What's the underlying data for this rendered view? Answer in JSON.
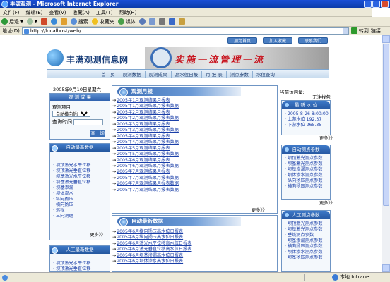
{
  "window": {
    "title": "丰满观测 - Microsoft Internet Explorer"
  },
  "menu": [
    "文件(F)",
    "编辑(E)",
    "查看(V)",
    "收藏(A)",
    "工具(T)",
    "帮助(H)"
  ],
  "toolbar": {
    "back": "后退",
    "search": "搜索",
    "favorites": "收藏夹",
    "media": "媒体"
  },
  "address": {
    "label": "地址(D)",
    "url": "http://localhost/web/",
    "go": "转到",
    "links": "链接"
  },
  "status": {
    "zone": "本地 Intranet"
  },
  "page": {
    "top_buttons": [
      "加为首页",
      "加入收藏",
      "联系我们"
    ],
    "site_name": "丰满观测信息网",
    "slogan": "实施一流管理一流",
    "nav": [
      "首　页",
      "观测数据",
      "观测成果",
      "高水位日报",
      "月 报 表",
      "测点参数",
      "水位查询"
    ],
    "date": "2005年9月10日星期六",
    "query_panel": {
      "title": "观 测 成 果",
      "item_label": "观测项目",
      "item_value": "自动横向拆压",
      "time_label": "查询时间",
      "button": "查　询"
    },
    "left_section1": {
      "title": "自动最新数据",
      "items": [
        "坝顶激光水平位移",
        "坝顶激光垂直位移",
        "坝基激光水平位移",
        "坝基激光垂直位移",
        "坝基渗漏",
        "坝体渗水",
        "纵向扬压",
        "横向扬压",
        "巡视",
        "三向测缝"
      ],
      "more": "更多》》"
    },
    "left_section2": {
      "title": "人工最新数据",
      "items": [
        "坝顶激光水平位移",
        "坝顶激光垂直位移"
      ]
    },
    "monthly": {
      "title": "观测月报",
      "items": [
        "2005年1月观测结果月报表",
        "2005年1月观测结果月报表数据",
        "2005年2月观测结果月报表",
        "2005年2月观测结果月报表数据",
        "2005年3月观测结果月报表",
        "2005年3月观测结果月报表数据",
        "2005年4月观测结果月报表",
        "2005年4月观测结果月报表数据",
        "2005年5月观测结果月报表",
        "2005年5月观测结果月报表数据",
        "2005年6月观测结果月报表",
        "2005年6月观测结果月报表数据",
        "2005年7月观测结果月报表",
        "2005年7月观测结果月报表数据"
      ],
      "more": "更多》》"
    },
    "auto_data": {
      "title": "自动最新数据",
      "items": [
        "2005年6月横向扬压高水位日报表",
        "2005年6月纵向扬压高水位日报表",
        "2005年6月激光水平位移高水位日报表",
        "2005年6月激光垂直位移高水位日报表",
        "2005年6月坝基渗漏高水位日报表",
        "2005年6月坝体渗水高水位日报表"
      ]
    },
    "visitor": {
      "label": "当前访问量:",
      "count": "无注找包"
    },
    "water": {
      "title": "最 新 水 位",
      "items": [
        "2005-8-26 8:00:00",
        "上游水位 192.37",
        "下游水位 265.35"
      ],
      "more": "更多》》"
    },
    "auto_points": {
      "title": "自动测点参数",
      "items": [
        "坝顶激光测点参数",
        "坝基激光测点参数",
        "坝基渗漏测点参数",
        "坝体渗水测点参数",
        "纵向扬压测点参数",
        "横向扬压测点参数"
      ],
      "more": "更多》》"
    },
    "manual_points": {
      "title": "人工测点参数",
      "items": [
        "坝顶激光测点参数",
        "坝基激光测点参数",
        "垂线测点参数",
        "坝基渗漏测点参数",
        "横向扬压测点参数",
        "坝体渗水测点参数",
        "坝基扬压测点参数"
      ]
    }
  }
}
